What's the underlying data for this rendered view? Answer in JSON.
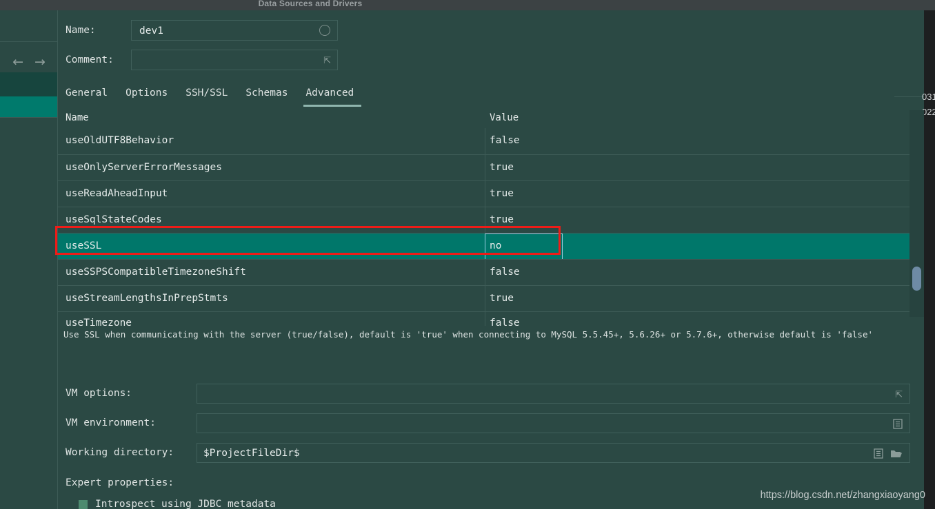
{
  "window": {
    "title": "Data Sources and Drivers"
  },
  "rail": {
    "back_icon": "←",
    "forward_icon": "→"
  },
  "right_edge": {
    "digits_top": "031",
    "digits_bottom": "022"
  },
  "header": {
    "name_label": "Name:",
    "name_value": "dev1",
    "comment_label": "Comment:",
    "comment_value": ""
  },
  "tabs": [
    {
      "label": "General",
      "active": false
    },
    {
      "label": "Options",
      "active": false
    },
    {
      "label": "SSH/SSL",
      "active": false
    },
    {
      "label": "Schemas",
      "active": false
    },
    {
      "label": "Advanced",
      "active": true
    }
  ],
  "table": {
    "columns": [
      "Name",
      "Value"
    ],
    "rows": [
      {
        "name": "useOldUTF8Behavior",
        "value": "false",
        "selected": false
      },
      {
        "name": "useOnlyServerErrorMessages",
        "value": "true",
        "selected": false
      },
      {
        "name": "useReadAheadInput",
        "value": "true",
        "selected": false
      },
      {
        "name": "useSqlStateCodes",
        "value": "true",
        "selected": false
      },
      {
        "name": "useSSL",
        "value": "no",
        "selected": true
      },
      {
        "name": "useSSPSCompatibleTimezoneShift",
        "value": "false",
        "selected": false
      },
      {
        "name": "useStreamLengthsInPrepStmts",
        "value": "true",
        "selected": false
      },
      {
        "name": "useTimezone",
        "value": "false",
        "selected": false
      }
    ]
  },
  "description": "Use SSL when communicating with the server (true/false), default is 'true' when connecting to MySQL 5.5.45+, 5.6.26+ or 5.7.6+, otherwise default is 'false'",
  "form": {
    "vm_options_label": "VM options:",
    "vm_options_value": "",
    "vm_environment_label": "VM environment:",
    "vm_environment_value": "",
    "working_directory_label": "Working directory:",
    "working_directory_value": "$ProjectFileDir$",
    "expert_properties_label": "Expert properties:",
    "introspect_label": "Introspect using JDBC metadata"
  },
  "watermark": "https://blog.csdn.net/zhangxiaoyang0",
  "colors": {
    "background": "#2b4944",
    "selection": "#00776a",
    "annotation": "#ee1c18",
    "rail_bright": "#007a6c",
    "rail_dark": "#17453e",
    "tab_underline": "#8fb5ae",
    "titlebar": "#3c4244"
  }
}
